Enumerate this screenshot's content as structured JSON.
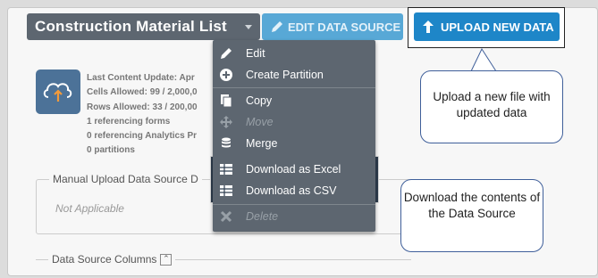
{
  "header": {
    "title": "Construction Material List",
    "edit_data_source_label": "EDIT DATA SOURCE",
    "upload_new_data_label": "UPLOAD NEW DATA"
  },
  "info": {
    "last_content_update": "Last Content Update: Apr",
    "cells_allowed": "Cells Allowed: 99 / 2,000,0",
    "rows_allowed": "Rows Allowed: 33 / 200,00",
    "referencing_forms": "1 referencing forms",
    "referencing_analytics": "0 referencing Analytics Pr",
    "partitions": "0 partitions"
  },
  "sections": {
    "manual_upload_legend": "Manual Upload Data Source D",
    "manual_upload_value": "Not Applicable",
    "columns_legend": "Data Source Columns"
  },
  "menu": {
    "items": [
      {
        "label": "Edit",
        "icon": "pencil-icon",
        "disabled": false
      },
      {
        "label": "Create Partition",
        "icon": "plus-circle-icon",
        "disabled": false
      },
      {
        "label": "Copy",
        "icon": "copy-icon",
        "disabled": false
      },
      {
        "label": "Move",
        "icon": "arrows-icon",
        "disabled": true
      },
      {
        "label": "Merge",
        "icon": "database-icon",
        "disabled": false
      },
      {
        "label": "Download as Excel",
        "icon": "table-icon",
        "disabled": false
      },
      {
        "label": "Download as CSV",
        "icon": "table-icon",
        "disabled": false
      },
      {
        "label": "Delete",
        "icon": "x-icon",
        "disabled": true
      }
    ]
  },
  "callouts": {
    "upload": "Upload a new file with updated data",
    "download": "Download the contents of the Data Source"
  },
  "colors": {
    "title_button": "#5d6670",
    "edit_button": "#58a8d6",
    "upload_button": "#1e86c8",
    "menu_bg": "#5d6670",
    "highlight_bg": "#2f3e4f",
    "callout_border": "#3f5f9a"
  }
}
